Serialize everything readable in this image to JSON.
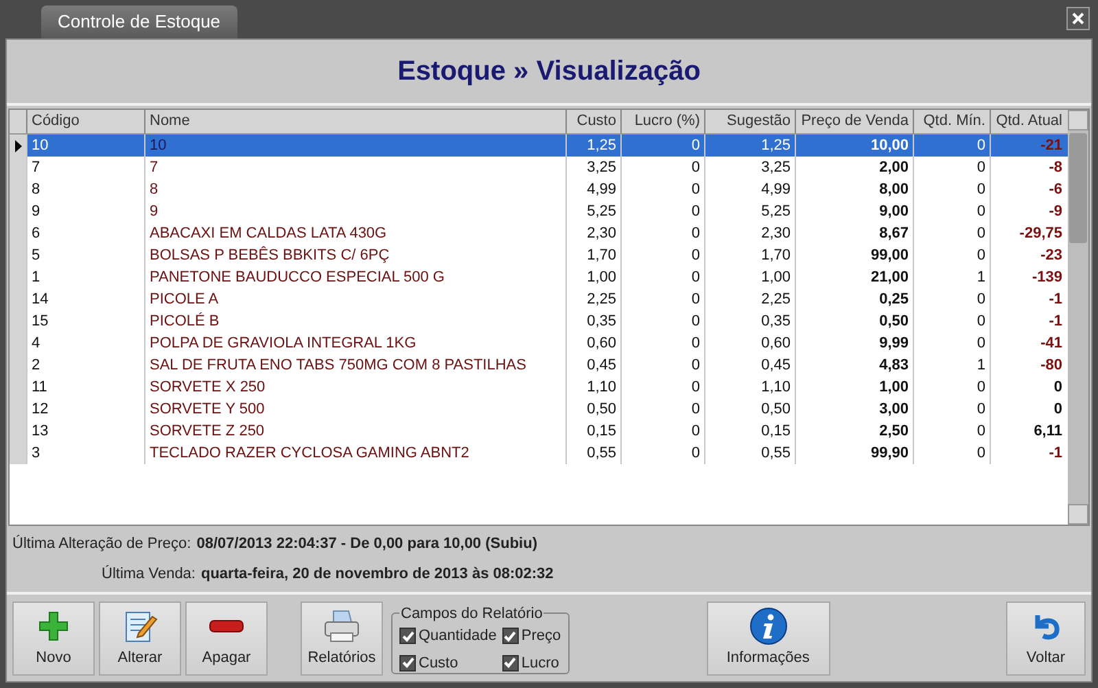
{
  "window": {
    "title": "Controle de Estoque"
  },
  "header": {
    "title": "Estoque » Visualização"
  },
  "table": {
    "columns": [
      "Código",
      "Nome",
      "Custo",
      "Lucro (%)",
      "Sugestão",
      "Preço de Venda",
      "Qtd. Mín.",
      "Qtd. Atual"
    ],
    "rows": [
      {
        "cells": [
          "10",
          "10",
          "1,25",
          "0",
          "1,25",
          "10,00",
          "0",
          "-21"
        ],
        "selected": true,
        "negative": true
      },
      {
        "cells": [
          "7",
          "7",
          "3,25",
          "0",
          "3,25",
          "2,00",
          "0",
          "-8"
        ],
        "selected": false,
        "negative": true
      },
      {
        "cells": [
          "8",
          "8",
          "4,99",
          "0",
          "4,99",
          "8,00",
          "0",
          "-6"
        ],
        "selected": false,
        "negative": true
      },
      {
        "cells": [
          "9",
          "9",
          "5,25",
          "0",
          "5,25",
          "9,00",
          "0",
          "-9"
        ],
        "selected": false,
        "negative": true
      },
      {
        "cells": [
          "6",
          "ABACAXI EM CALDAS LATA 430G",
          "2,30",
          "0",
          "2,30",
          "8,67",
          "0",
          "-29,75"
        ],
        "selected": false,
        "negative": true
      },
      {
        "cells": [
          "5",
          "BOLSAS P BEBÊS BBKITS C/ 6PÇ",
          "1,70",
          "0",
          "1,70",
          "99,00",
          "0",
          "-23"
        ],
        "selected": false,
        "negative": true
      },
      {
        "cells": [
          "1",
          "PANETONE BAUDUCCO ESPECIAL 500 G",
          "1,00",
          "0",
          "1,00",
          "21,00",
          "1",
          "-139"
        ],
        "selected": false,
        "negative": true
      },
      {
        "cells": [
          "14",
          "PICOLE A",
          "2,25",
          "0",
          "2,25",
          "0,25",
          "0",
          "-1"
        ],
        "selected": false,
        "negative": true
      },
      {
        "cells": [
          "15",
          "PICOLÉ B",
          "0,35",
          "0",
          "0,35",
          "0,50",
          "0",
          "-1"
        ],
        "selected": false,
        "negative": true
      },
      {
        "cells": [
          "4",
          "POLPA DE GRAVIOLA INTEGRAL 1KG",
          "0,60",
          "0",
          "0,60",
          "9,99",
          "0",
          "-41"
        ],
        "selected": false,
        "negative": true
      },
      {
        "cells": [
          "2",
          "SAL DE FRUTA ENO TABS 750MG COM 8 PASTILHAS",
          "0,45",
          "0",
          "0,45",
          "4,83",
          "1",
          "-80"
        ],
        "selected": false,
        "negative": true
      },
      {
        "cells": [
          "11",
          "SORVETE X 250",
          "1,10",
          "0",
          "1,10",
          "1,00",
          "0",
          "0"
        ],
        "selected": false,
        "negative": false
      },
      {
        "cells": [
          "12",
          "SORVETE Y 500",
          "0,50",
          "0",
          "0,50",
          "3,00",
          "0",
          "0"
        ],
        "selected": false,
        "negative": false
      },
      {
        "cells": [
          "13",
          "SORVETE Z 250",
          "0,15",
          "0",
          "0,15",
          "2,50",
          "0",
          "6,11"
        ],
        "selected": false,
        "negative": false
      },
      {
        "cells": [
          "3",
          "TECLADO RAZER CYCLOSA GAMING ABNT2",
          "0,55",
          "0",
          "0,55",
          "99,90",
          "0",
          "-1"
        ],
        "selected": false,
        "negative": true
      }
    ]
  },
  "info": [
    {
      "label": "Última Alteração de Preço:",
      "value": "08/07/2013 22:04:37 - De 0,00 para 10,00 (Subiu)"
    },
    {
      "label": "Última Venda:",
      "value": "quarta-feira, 20 de novembro de 2013 às 08:02:32"
    }
  ],
  "toolbar": {
    "buttons": [
      {
        "label": "Novo",
        "kind": "plus"
      },
      {
        "label": "Alterar",
        "kind": "edit"
      },
      {
        "label": "Apagar",
        "kind": "minus"
      },
      {
        "label": "Relatórios",
        "kind": "printer"
      }
    ],
    "report_fields": {
      "title": "Campos do Relatório",
      "options": [
        {
          "label": "Quantidade",
          "checked": true
        },
        {
          "label": "Preço",
          "checked": true
        },
        {
          "label": "Custo",
          "checked": true
        },
        {
          "label": "Lucro",
          "checked": true
        }
      ]
    },
    "info_button": {
      "label": "Informações"
    },
    "back_button": {
      "label": "Voltar"
    }
  }
}
